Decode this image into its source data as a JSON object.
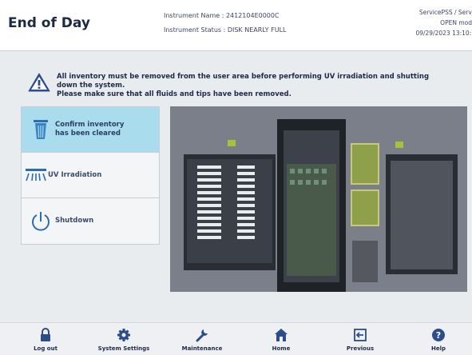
{
  "header": {
    "title": "End of Day",
    "instrument_name": "Instrument Name : 2412104E0000C",
    "instrument_status": "Instrument Status : DISK NEARLY FULL",
    "user_role": "ServicePSS / Servic",
    "mode": "OPEN mod",
    "datetime": "09/29/2023 13:10:3"
  },
  "warning": {
    "line1": "All inventory must be removed from the user area before performing UV irradiation and shutting",
    "line2": "down the system.",
    "line3": "Please make sure that all fluids and tips have been removed."
  },
  "steps": [
    {
      "label_line1": "Confirm inventory",
      "label_line2": "has been cleared",
      "icon": "trash-icon",
      "active": true
    },
    {
      "label_line1": "UV Irradiation",
      "label_line2": "",
      "icon": "uv-lamp-icon",
      "active": false
    },
    {
      "label_line1": "Shutdown",
      "label_line2": "",
      "icon": "power-icon",
      "active": false
    }
  ],
  "toolbar": {
    "logout": "Log out",
    "system_settings": "System Settings",
    "maintenance": "Maintenance",
    "home": "Home",
    "previous": "Previous",
    "help": "Help"
  },
  "colors": {
    "accent": "#2c4c8c",
    "active_step": "#a9dced",
    "deck_bg": "#7a7f8a"
  }
}
